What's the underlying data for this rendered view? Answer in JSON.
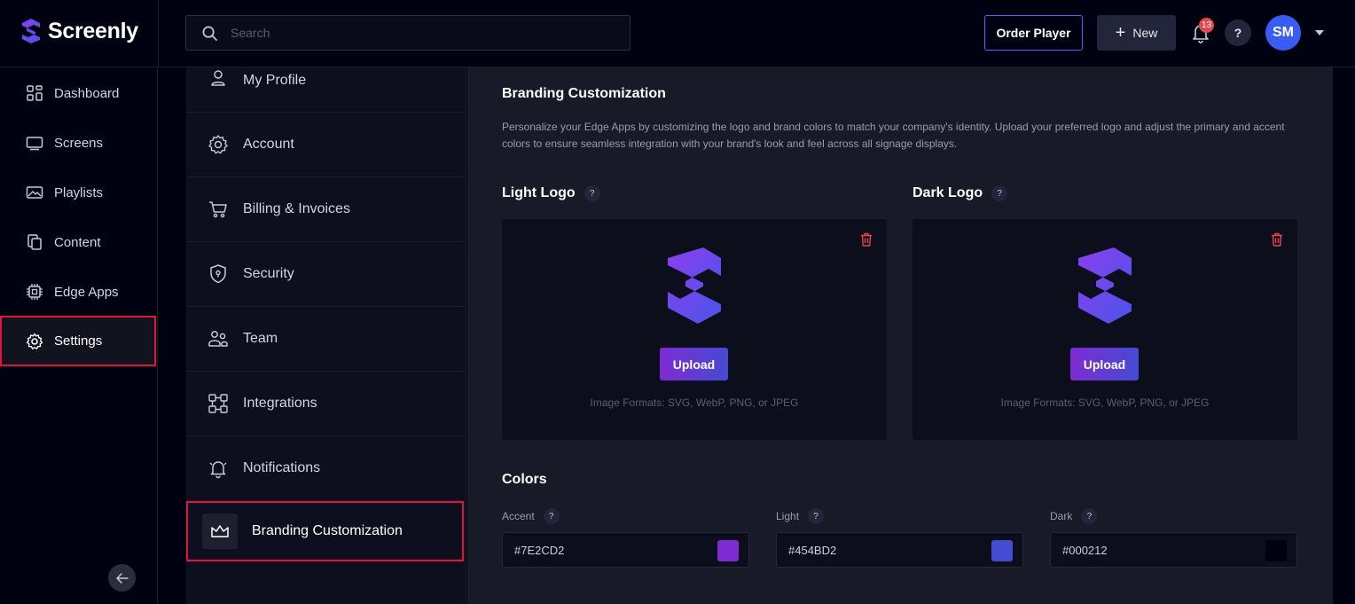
{
  "app": {
    "name": "Screenly"
  },
  "search": {
    "placeholder": "Search",
    "value": ""
  },
  "header": {
    "order_player_label": "Order Player",
    "new_label": "New",
    "notification_count": "13",
    "help_label": "?",
    "avatar_initials": "SM"
  },
  "sidebar": {
    "items": [
      {
        "label": "Dashboard",
        "icon": "dashboard-icon"
      },
      {
        "label": "Screens",
        "icon": "screen-icon"
      },
      {
        "label": "Playlists",
        "icon": "playlist-icon"
      },
      {
        "label": "Content",
        "icon": "content-icon"
      },
      {
        "label": "Edge Apps",
        "icon": "chip-icon"
      },
      {
        "label": "Settings",
        "icon": "gear-icon",
        "active": true
      }
    ]
  },
  "settings_menu": {
    "items": [
      {
        "label": "My Profile",
        "icon": "user-icon"
      },
      {
        "label": "Account",
        "icon": "gear-icon"
      },
      {
        "label": "Billing & Invoices",
        "icon": "cart-icon"
      },
      {
        "label": "Security",
        "icon": "shield-icon"
      },
      {
        "label": "Team",
        "icon": "team-icon"
      },
      {
        "label": "Integrations",
        "icon": "integrations-icon"
      },
      {
        "label": "Notifications",
        "icon": "bell-icon"
      },
      {
        "label": "Branding Customization",
        "icon": "crown-icon",
        "active": true
      }
    ]
  },
  "branding": {
    "title": "Branding Customization",
    "description": "Personalize your Edge Apps by customizing the logo and brand colors to match your company's identity. Upload your preferred logo and adjust the primary and accent colors to ensure seamless integration with your brand's look and feel across all signage displays.",
    "light_logo": {
      "label": "Light Logo",
      "help": "?",
      "upload_label": "Upload",
      "formats": "Image Formats: SVG, WebP, PNG, or JPEG"
    },
    "dark_logo": {
      "label": "Dark Logo",
      "help": "?",
      "upload_label": "Upload",
      "formats": "Image Formats: SVG, WebP, PNG, or JPEG"
    }
  },
  "colors": {
    "title": "Colors",
    "accent": {
      "label": "Accent",
      "help": "?",
      "value": "#7E2CD2"
    },
    "light": {
      "label": "Light",
      "help": "?",
      "value": "#454BD2"
    },
    "dark": {
      "label": "Dark",
      "help": "?",
      "value": "#000212"
    }
  },
  "theme": {
    "danger": "#e5484d",
    "selection_outline": "#e0143c",
    "brand_purple": "#7b4ff0",
    "avatar_blue": "#3a5cf5"
  }
}
